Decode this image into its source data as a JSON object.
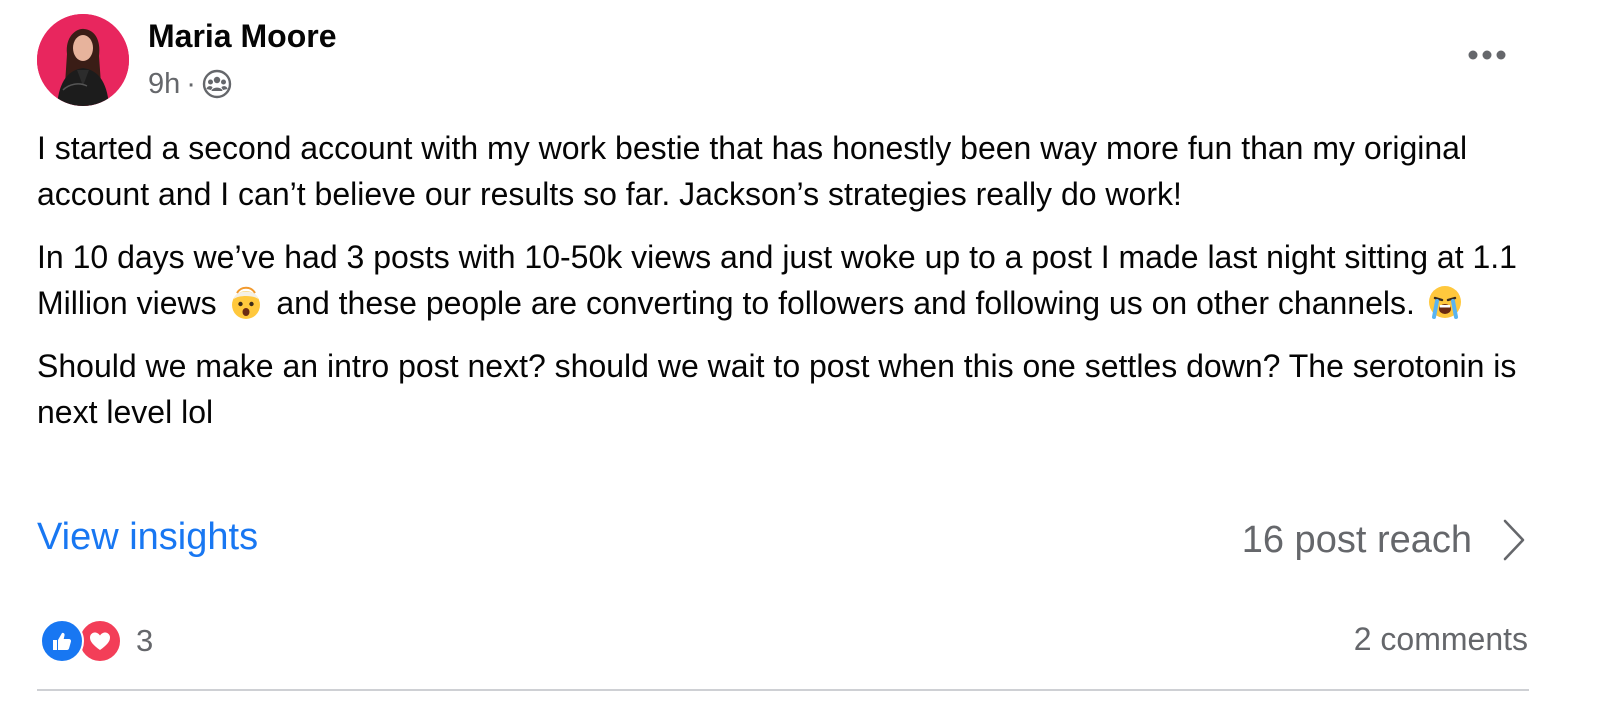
{
  "post": {
    "author": "Maria Moore",
    "time": "9h",
    "separator": "·",
    "audience_icon": "group-icon",
    "more_icon": "ellipsis-icon",
    "paragraphs": [
      {
        "text": "I started a second account with my work bestie that has honestly been way more fun than my original account and I can’t believe our results so far. Jackson’s strategies really do work!"
      },
      {
        "text_before_emoji_1": "In 10 days we’ve had 3 posts with 10-50k views and just woke up to a post I made last night sitting at 1.1 Million views ",
        "emoji_1": "exploding-head-emoji",
        "text_before_emoji_2": " and these people are converting to followers and following us on other channels. ",
        "emoji_2": "loudly-crying-face-emoji"
      },
      {
        "text": "Should we make an intro post next? should we wait to post when this one settles down? The serotonin is next level lol"
      }
    ],
    "insights_link": "View insights",
    "reach_text": "16 post reach",
    "reactions": {
      "icons": [
        "like-icon",
        "love-icon"
      ],
      "count": "3"
    },
    "comments_text": "2 comments"
  },
  "colors": {
    "link": "#1877f2",
    "secondary_text": "#65676b",
    "primary_text": "#050505",
    "avatar_bg": "#e8265e",
    "like": "#1877f2",
    "love": "#f33e58",
    "divider": "#ced0d4"
  }
}
